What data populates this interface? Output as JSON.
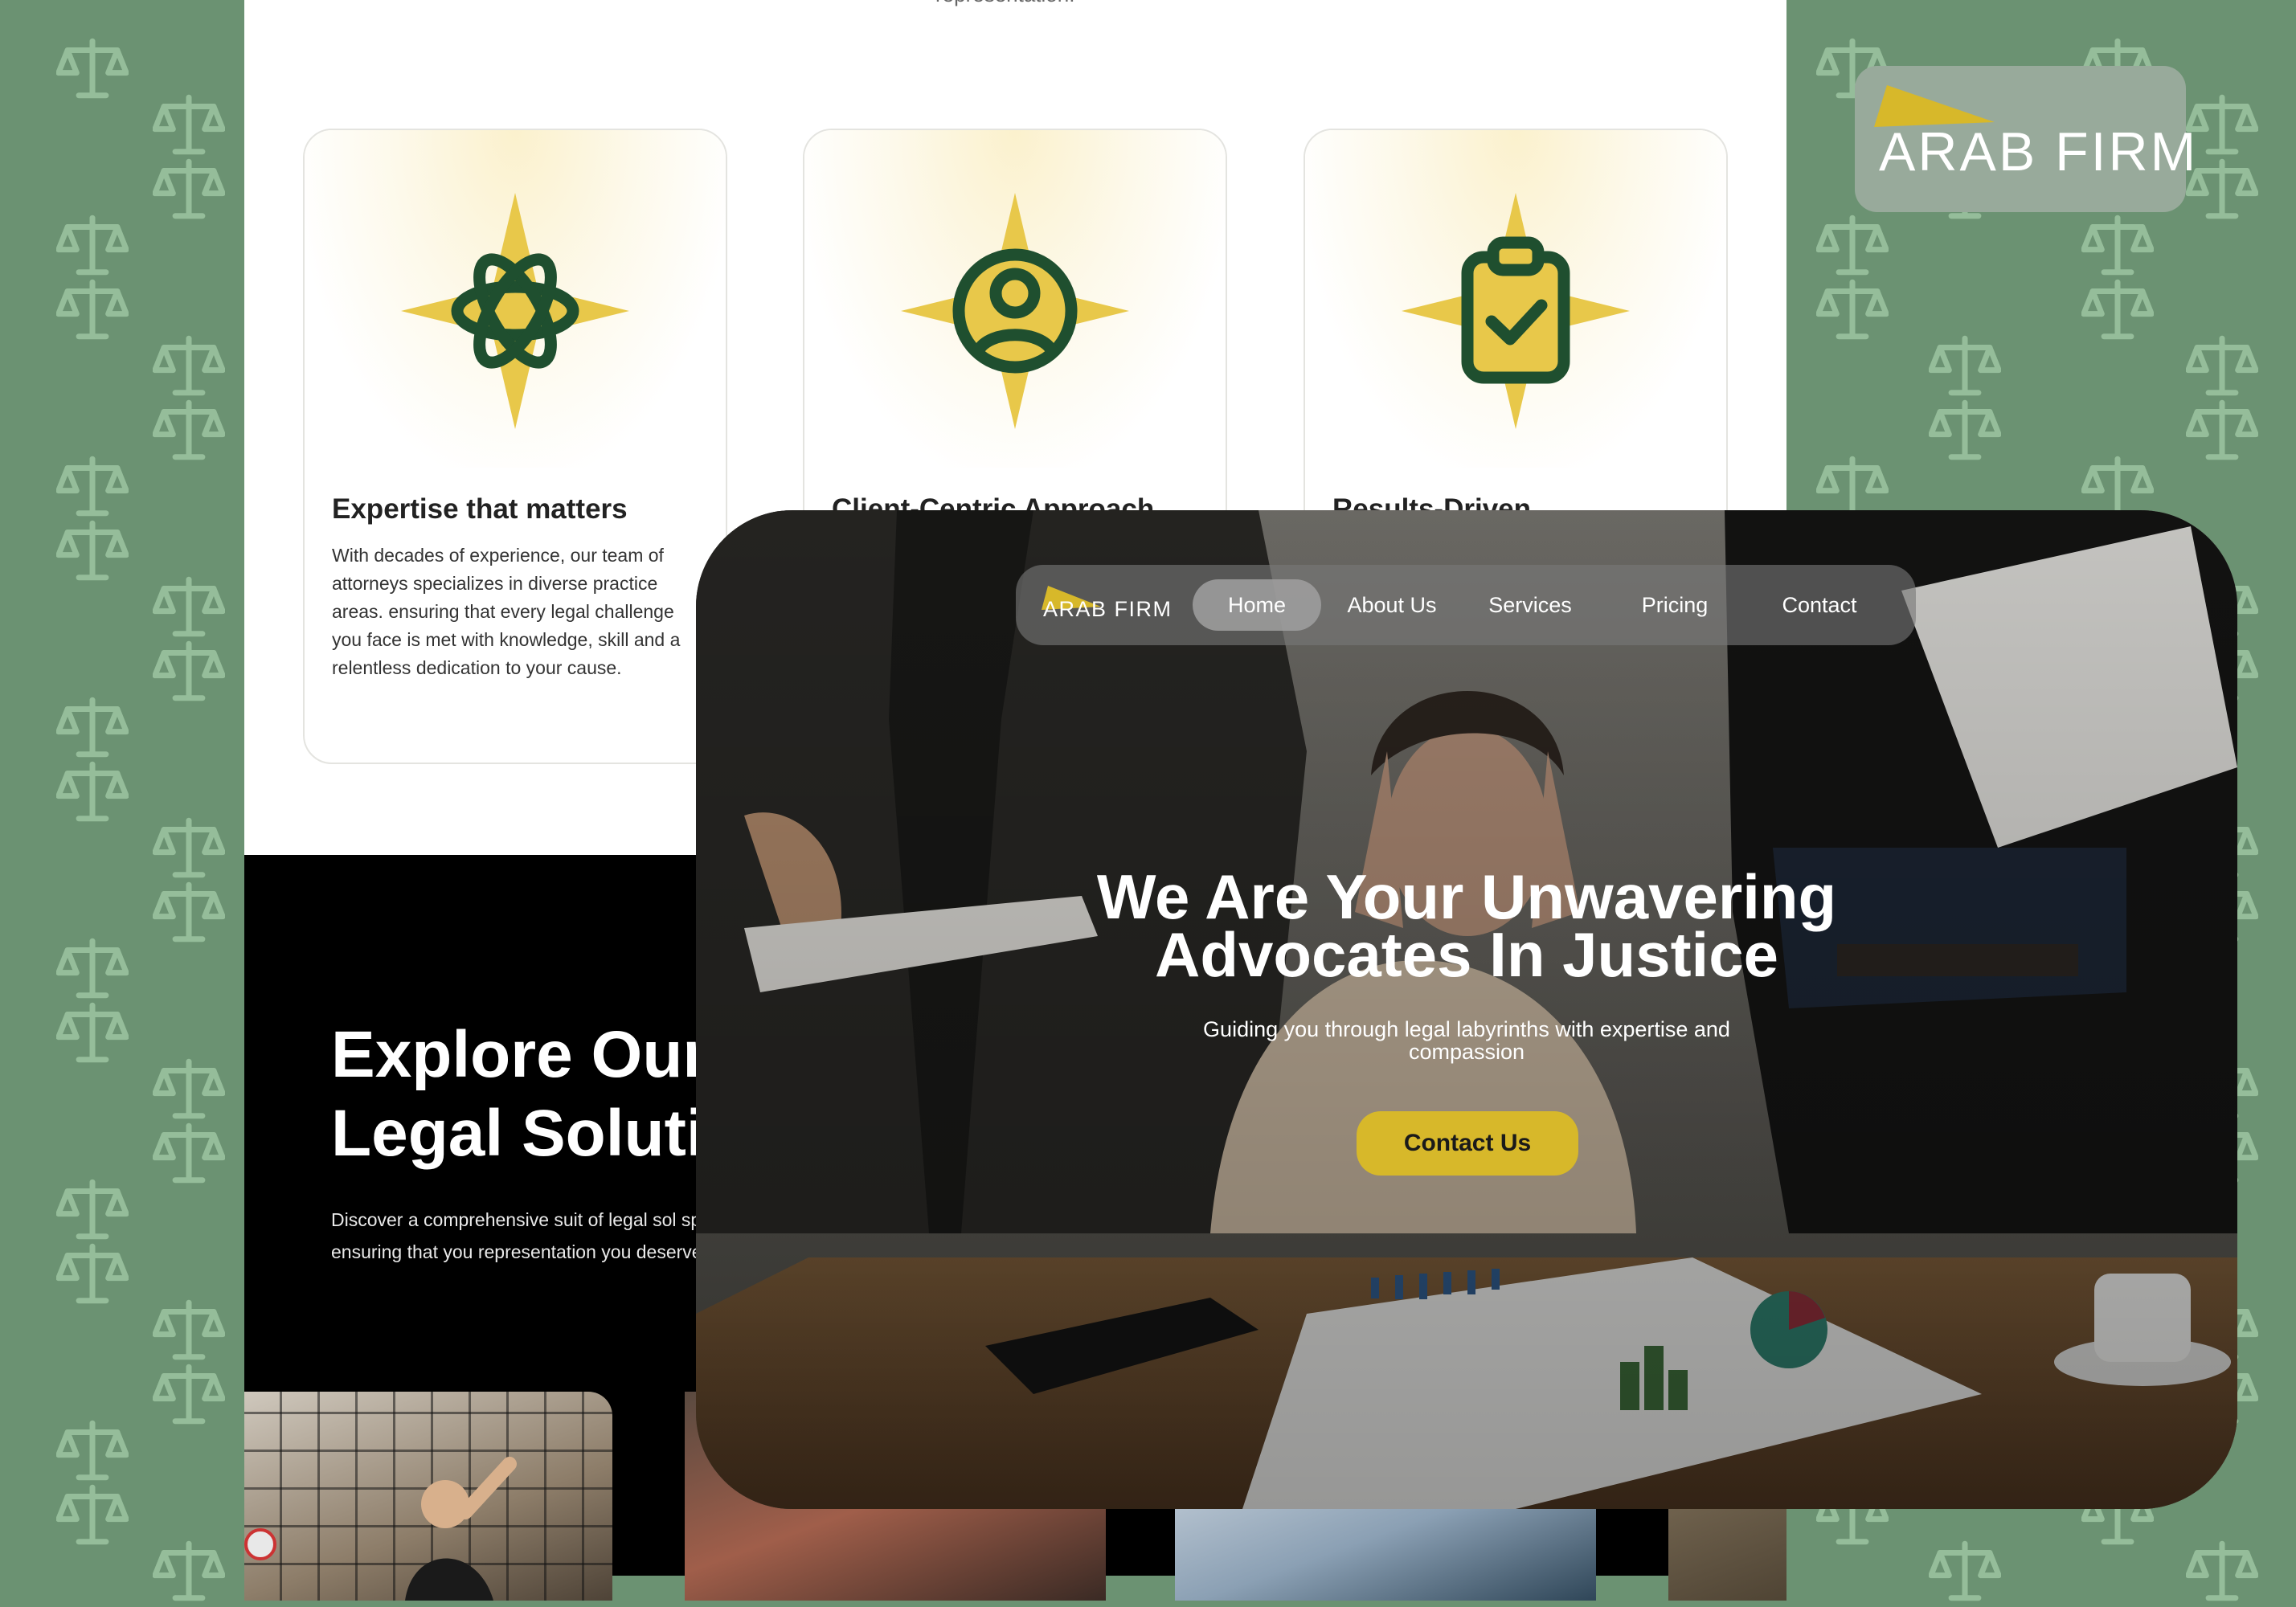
{
  "brand": {
    "name": "ARAB FIRM"
  },
  "features": {
    "cut_text": "representation.",
    "cards": [
      {
        "title": "Expertise that matters",
        "text": "With decades of experience, our team of attorneys  specializes in diverse practice areas. ensuring that every legal challenge you face is met with knowledge, skill and a relentless dedication to your cause.",
        "icon": "atom-icon"
      },
      {
        "title": "Client-Centric Approach",
        "icon": "user-circle-icon"
      },
      {
        "title": "Results-Driven",
        "icon": "clipboard-check-icon"
      }
    ]
  },
  "explore": {
    "title_line1": "Explore Our",
    "title_line2": "Legal Soluti",
    "text": "Discover a comprehensive suit of legal sol specific circumstances, ensuring that you representation you deserve."
  },
  "hero": {
    "nav": {
      "logo": "ARAB FIRM",
      "items": [
        "Home",
        "About Us",
        "Services",
        "Pricing",
        "Contact"
      ],
      "active": "Home"
    },
    "title_line1": "We Are Your Unwavering",
    "title_line2": "Advocates In Justice",
    "subtitle": "Guiding you through legal labyrinths with expertise and compassion",
    "cta": "Contact Us"
  },
  "colors": {
    "background": "#6b9272",
    "pattern": "#95bd9a",
    "accent_gold": "#d7b82a",
    "icon_green": "#1f4f2f",
    "star_yellow": "#e8c84a"
  }
}
